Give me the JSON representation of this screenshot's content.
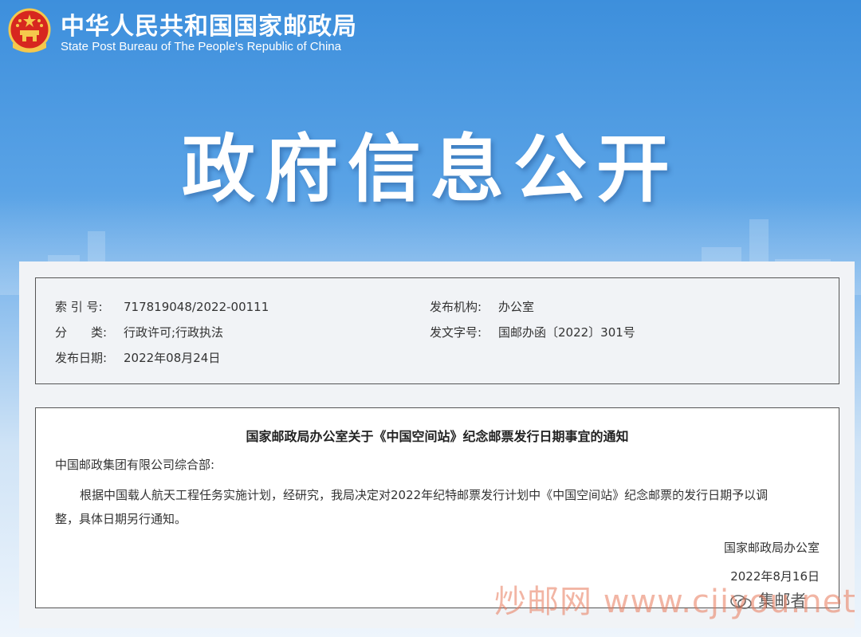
{
  "header": {
    "title_cn": "中华人民共和国国家邮政局",
    "title_en": "State Post Bureau of The People's Republic of China",
    "emblem_icon": "national-emblem-icon"
  },
  "banner": {
    "title": "政府信息公开"
  },
  "meta": {
    "index_label": "索 引 号:",
    "index_value": "717819048/2022-00111",
    "category_label": "分　　类:",
    "category_value": "行政许可;行政执法",
    "date_label": "发布日期:",
    "date_value": "2022年08月24日",
    "org_label": "发布机构:",
    "org_value": "办公室",
    "docno_label": "发文字号:",
    "docno_value": "国邮办函〔2022〕301号"
  },
  "article": {
    "title": "国家邮政局办公室关于《中国空间站》纪念邮票发行日期事宜的通知",
    "addressee": "中国邮政集团有限公司综合部:",
    "body_line1": "根据中国载人航天工程任务实施计划，经研究，我局决定对2022年纪特邮票发行计划中《中国空间站》纪念邮票的发行日期予以调",
    "body_line2": "整，具体日期另行通知。",
    "signature": "国家邮政局办公室",
    "sign_date": "2022年8月16日"
  },
  "watermark": {
    "text": "炒邮网 www.cjiyou.net",
    "source": "集邮者",
    "source_icon": "wechat-icon"
  },
  "colors": {
    "banner_blue": "#3d8fdc",
    "emblem_red": "#d7271f",
    "emblem_gold": "#f5c84c"
  }
}
